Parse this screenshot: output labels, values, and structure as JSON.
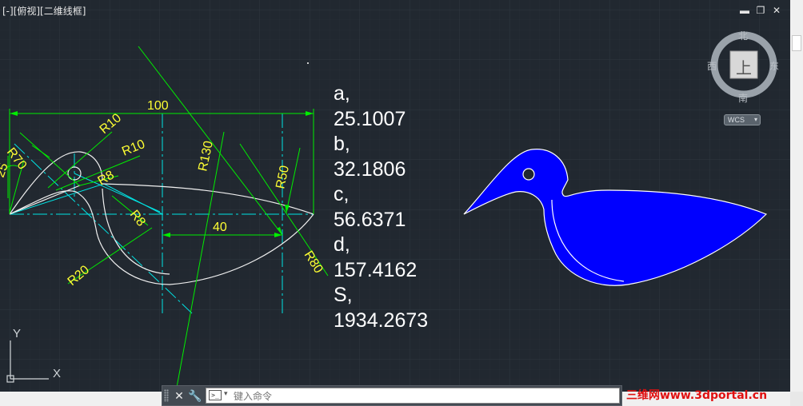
{
  "viewport": {
    "label": "[-][俯视][二维线框]"
  },
  "window_controls": {
    "minimize": "▬",
    "restore": "❐",
    "close": "✕"
  },
  "viewcube": {
    "north": "北",
    "south": "南",
    "east": "东",
    "west": "西",
    "face": "上",
    "wcs_label": "WCS"
  },
  "dimensions": {
    "d100": "100",
    "r10a": "R10",
    "r10b": "R10",
    "r70": "R70",
    "d25": "25",
    "r8a": "R8",
    "r8b": "R8",
    "r130": "R130",
    "r50": "R50",
    "d40": "40",
    "r80": "R80",
    "r20": "R20"
  },
  "results": [
    "a,",
    "25.1007",
    "b,",
    "32.1806",
    "c,",
    "56.6371",
    "d,",
    "157.4162",
    "S,",
    "1934.2673"
  ],
  "ucs": {
    "y": "Y",
    "x": "X"
  },
  "command_line": {
    "placeholder": "键入命令"
  },
  "watermark": "三维网www.3dportal.cn",
  "colors": {
    "background": "#212830",
    "dimension": "#00ff00",
    "dim_text": "#ffff00",
    "centerline": "#00ffff",
    "outline": "#ffffff",
    "fill": "#0000ff"
  }
}
